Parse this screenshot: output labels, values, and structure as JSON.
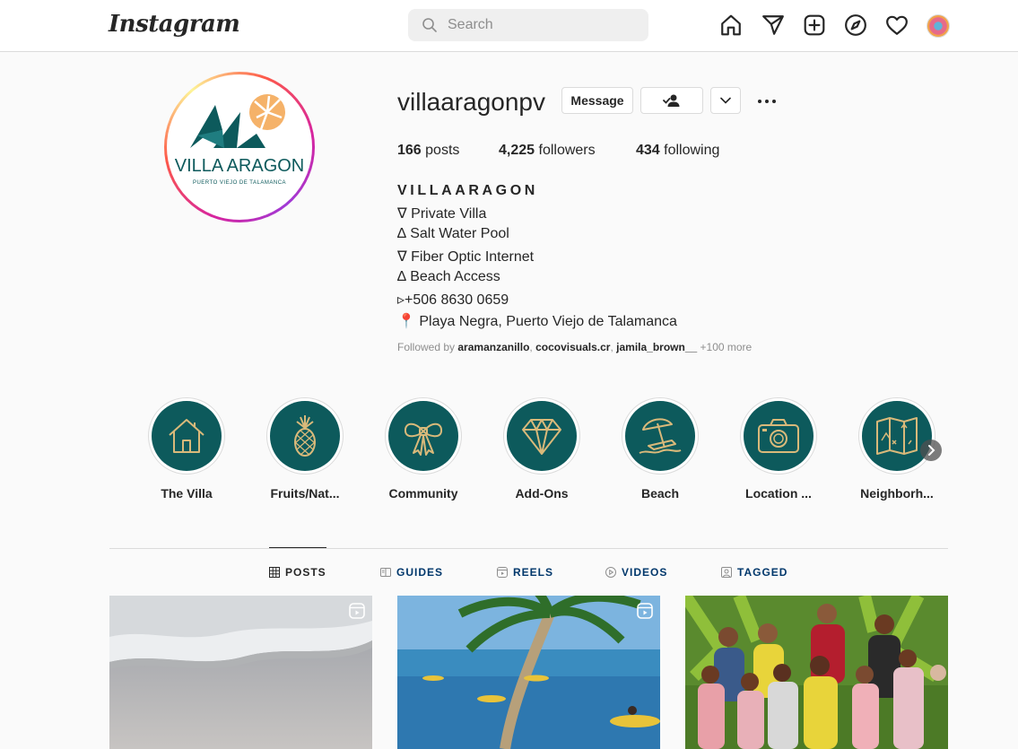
{
  "app": {
    "logo": "Instagram"
  },
  "search": {
    "placeholder": "Search"
  },
  "nav": {
    "icons": [
      "home-icon",
      "direct-message-icon",
      "new-post-icon",
      "explore-icon",
      "activity-heart-icon",
      "profile-avatar"
    ]
  },
  "profile": {
    "username": "villaaragonpv",
    "logo_text": "VILLA ARAGON",
    "logo_subtext": "PUERTO VIEJO DE TALAMANCA",
    "message_label": "Message",
    "posts_count": "166",
    "posts_label": " posts",
    "followers_count": "4,225",
    "followers_label": " followers",
    "following_count": "434",
    "following_label": " following",
    "bio_name": "VILLAARAGON",
    "bio_lines": [
      "∇ Private Villa",
      "∆ Salt Water Pool",
      "∇ Fiber Optic Internet",
      "∆ Beach Access",
      "▹+506 8630 0659",
      "📍 Playa Negra, Puerto Viejo de Talamanca"
    ],
    "followed_by_prefix": "Followed by ",
    "followed_by_users": [
      "aramanzanillo",
      "cocovisuals.cr",
      "jamila_brown__"
    ],
    "followed_by_sep": ", ",
    "followed_by_more": " +100 more"
  },
  "highlights": [
    {
      "label": "The Villa",
      "icon": "house-icon"
    },
    {
      "label": "Fruits/Nat...",
      "icon": "pineapple-icon"
    },
    {
      "label": "Community",
      "icon": "bow-icon"
    },
    {
      "label": "Add-Ons",
      "icon": "diamond-icon"
    },
    {
      "label": "Beach",
      "icon": "beach-umbrella-icon"
    },
    {
      "label": "Location ...",
      "icon": "camera-icon"
    },
    {
      "label": "Neighborh...",
      "icon": "map-icon"
    }
  ],
  "tabs": [
    {
      "label": "POSTS",
      "icon": "grid-icon",
      "active": true
    },
    {
      "label": "GUIDES",
      "icon": "guides-icon",
      "active": false
    },
    {
      "label": "REELS",
      "icon": "reels-icon",
      "active": false
    },
    {
      "label": "VIDEOS",
      "icon": "video-icon",
      "active": false
    },
    {
      "label": "TAGGED",
      "icon": "tagged-icon",
      "active": false
    }
  ],
  "colors": {
    "accent_teal": "#0d5a5c",
    "highlight_gold": "#d9b97a",
    "text": "#262626",
    "muted": "#8e8e8e",
    "tab_link": "#00376b"
  }
}
